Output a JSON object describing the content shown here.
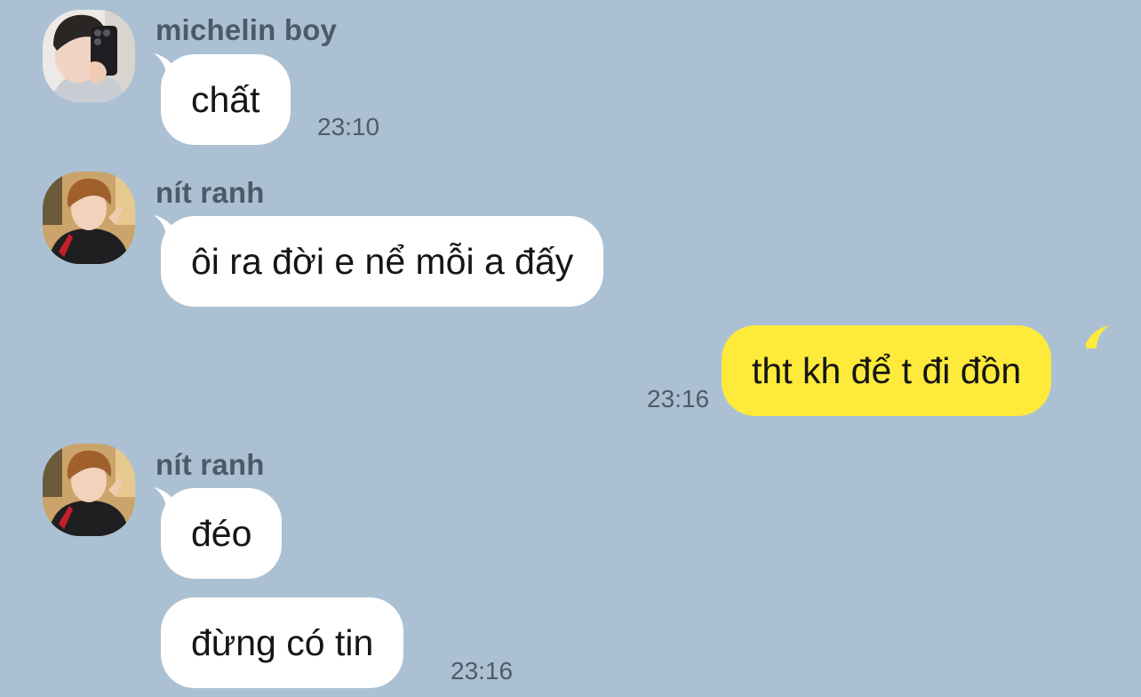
{
  "colors": {
    "background": "#abc1d3",
    "incoming_bubble": "#ffffff",
    "outgoing_bubble": "#feea3a",
    "sender_name": "#4d5a67",
    "timestamp": "#4f5b66"
  },
  "messages": [
    {
      "sender": "michelin boy",
      "avatar_icon": "user-avatar-mirror-selfie",
      "text": "chất",
      "time": "23:10",
      "direction": "incoming"
    },
    {
      "sender": "nít ranh",
      "avatar_icon": "user-avatar-selfie",
      "text": "ôi ra đời e nể mỗi a đấy",
      "time": "",
      "direction": "incoming"
    },
    {
      "sender": "",
      "text": "tht kh để t đi đồn",
      "time": "23:16",
      "direction": "outgoing"
    },
    {
      "sender": "nít ranh",
      "avatar_icon": "user-avatar-selfie",
      "text": "đéo",
      "time": "",
      "direction": "incoming"
    },
    {
      "sender": "",
      "text": "đừng có tin",
      "time": "23:16",
      "direction": "incoming"
    }
  ]
}
